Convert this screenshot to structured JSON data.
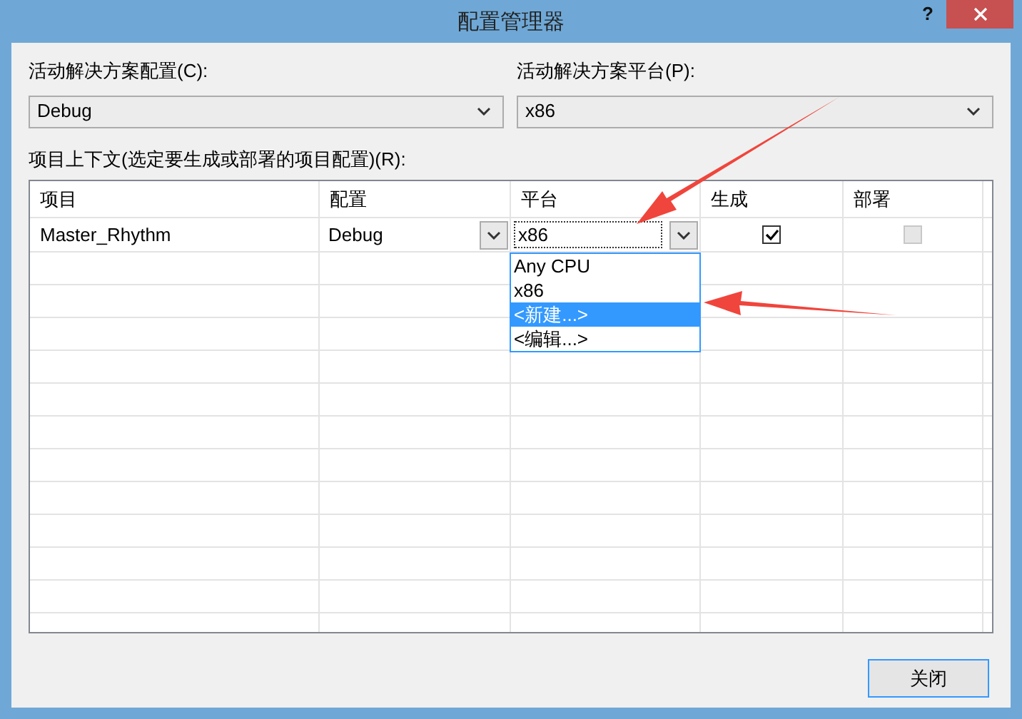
{
  "window": {
    "title": "配置管理器",
    "help": "?"
  },
  "solution_config": {
    "label": "活动解决方案配置(C):",
    "value": "Debug"
  },
  "solution_platform": {
    "label": "活动解决方案平台(P):",
    "value": "x86"
  },
  "context_label": "项目上下文(选定要生成或部署的项目配置)(R):",
  "table": {
    "columns": [
      "项目",
      "配置",
      "平台",
      "生成",
      "部署"
    ],
    "rows": [
      {
        "project": "Master_Rhythm",
        "config": "Debug",
        "platform": "x86",
        "build": {
          "checked": true,
          "disabled": false
        },
        "deploy": {
          "checked": false,
          "disabled": true
        }
      }
    ]
  },
  "platform_dropdown": {
    "options": [
      {
        "label": "Any CPU",
        "selected": false
      },
      {
        "label": "x86",
        "selected": false
      },
      {
        "label": "<新建...>",
        "selected": true
      },
      {
        "label": "<编辑...>",
        "selected": false
      }
    ]
  },
  "buttons": [
    {
      "label": "关闭",
      "focused": true
    }
  ]
}
